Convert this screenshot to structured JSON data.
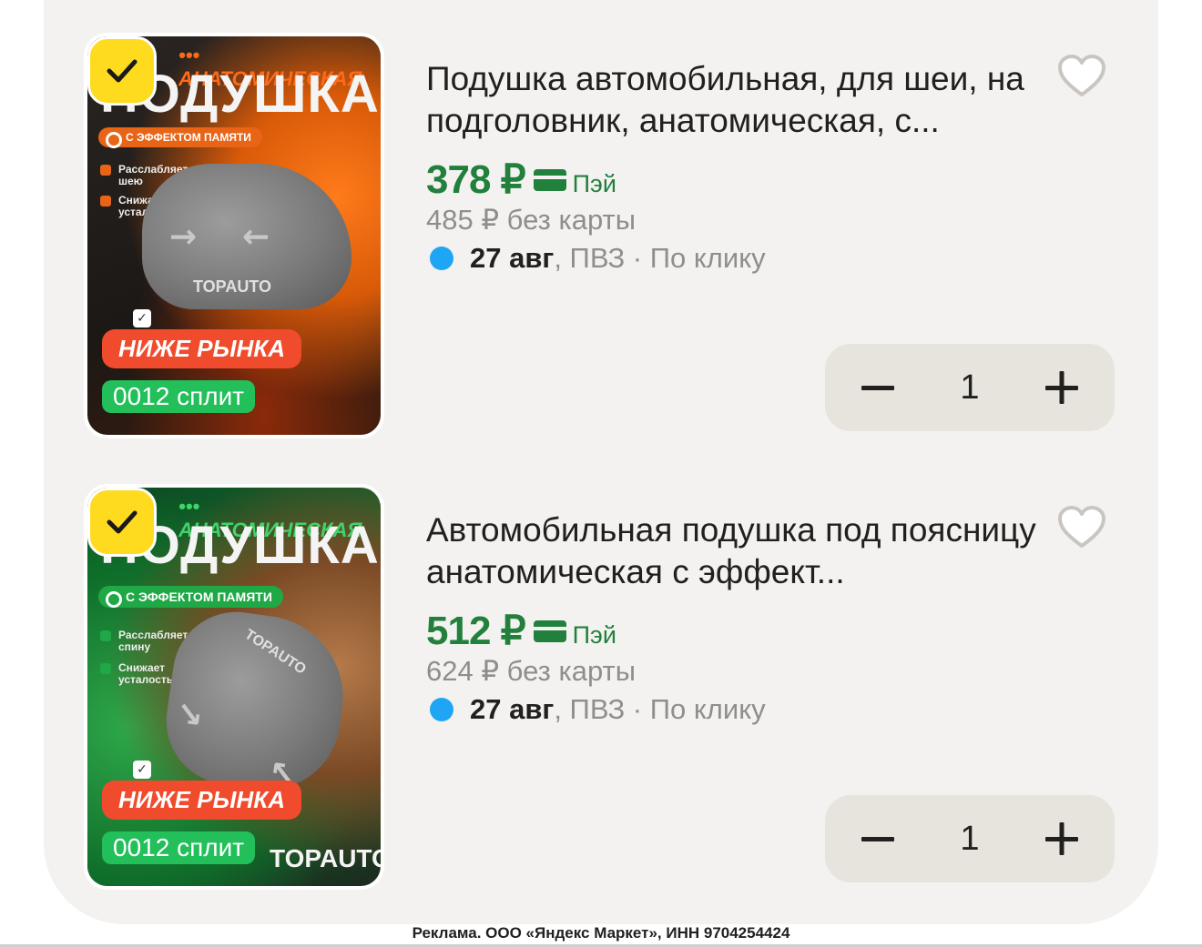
{
  "products": [
    {
      "image": {
        "headline_small": "••• АНАТОМИЧЕСКАЯ",
        "headline_big": "ПОДУШКА",
        "memory_tag": "С ЭФФЕКТОМ ПАМЯТИ",
        "feature_1": "Расслабляет шею",
        "feature_2": "Снижает усталость",
        "brand": "TOPAUTO",
        "badge_below": "НИЖЕ РЫНКА",
        "badge_split": "0012 сплит",
        "theme": "orange"
      },
      "title": "Подушка автомобильная, для шеи, на подголовник, анатомическая, с...",
      "price": "378 ₽",
      "pay_label": "Пэй",
      "old_price": "485 ₽ без карты",
      "delivery_date": "27 авг",
      "delivery_rest": ", ПВЗ · По клику",
      "quantity": "1",
      "favorite_icon": "heart-outline-icon"
    },
    {
      "image": {
        "headline_small": "••• АНАТОМИЧЕСКАЯ",
        "headline_big": "ПОДУШКА",
        "memory_tag": "С ЭФФЕКТОМ ПАМЯТИ",
        "feature_1": "Расслабляет спину",
        "feature_2": "Снижает усталость",
        "brand": "TOPAUTO",
        "brand_bottom": "TOPAUTO",
        "badge_below": "НИЖЕ РЫНКА",
        "badge_split": "0012 сплит",
        "theme": "green"
      },
      "title": "Автомобильная подушка под поясницу анатомическая с эффект...",
      "price": "512 ₽",
      "pay_label": "Пэй",
      "old_price": "624 ₽ без карты",
      "delivery_date": "27 авг",
      "delivery_rest": ", ПВЗ · По клику",
      "quantity": "1",
      "favorite_icon": "heart-outline-icon"
    }
  ],
  "colors": {
    "price_green": "#21803b",
    "delivery_dot": "#1ea6f5",
    "check_badge_yellow": "#ffdb1f",
    "stepper_bg": "#e7e4de"
  },
  "footer": {
    "ad_text": "Реклама. ООО «Яндекс Маркет», ИНН 9704254424"
  }
}
